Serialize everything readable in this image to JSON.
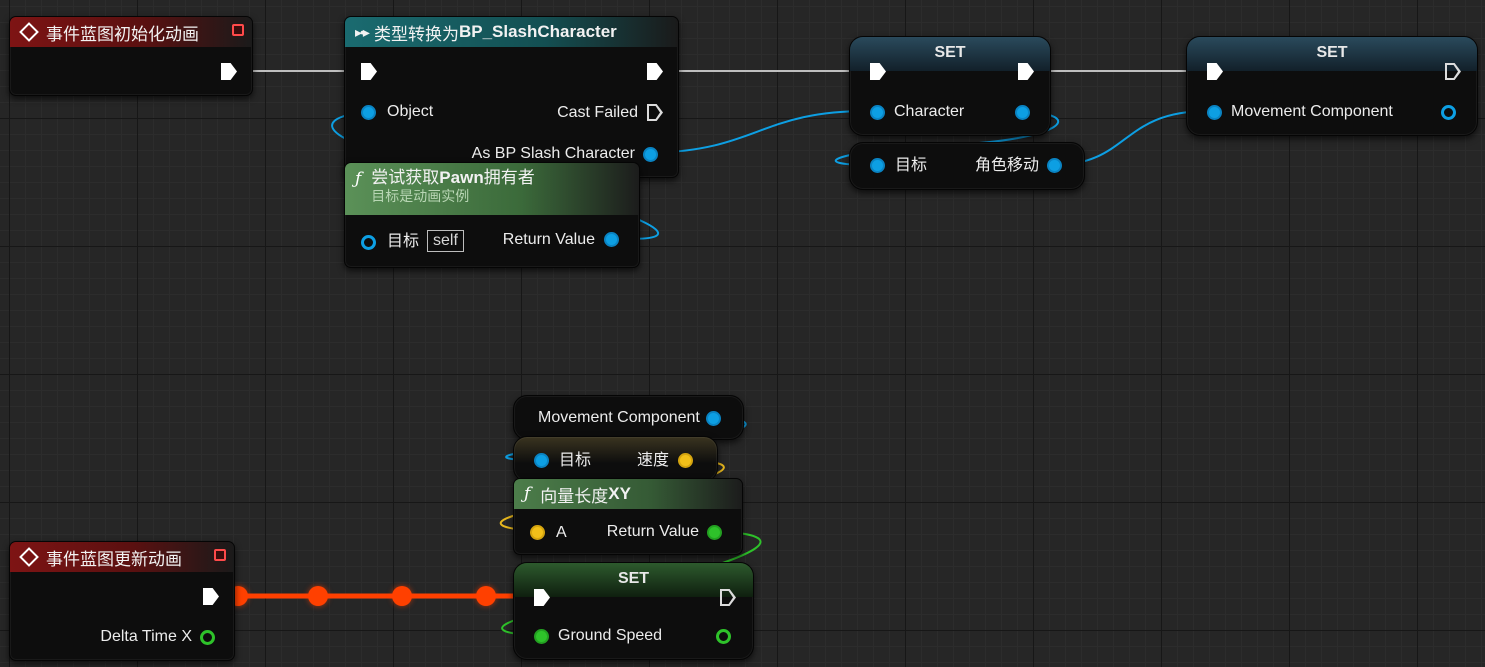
{
  "event_init": {
    "title": "事件蓝图初始化动画"
  },
  "cast": {
    "title_prefix": "类型转换为 ",
    "title_bold": "BP_SlashCharacter",
    "object_label": "Object",
    "cast_failed_label": "Cast Failed",
    "as_label": "As BP Slash Character"
  },
  "get_pawn": {
    "title_prefix": "尝试获取",
    "title_bold": "Pawn",
    "title_suffix": "拥有者",
    "subtitle": "目标是动画实例",
    "target_label": "目标",
    "self_label": "self",
    "return_label": "Return Value"
  },
  "set_character": {
    "title": "SET",
    "pin_label": "Character"
  },
  "get_movement": {
    "target_label": "目标",
    "output_label": "角色移动"
  },
  "set_movement": {
    "title": "SET",
    "pin_label": "Movement Component"
  },
  "movement_var": {
    "label": "Movement Component"
  },
  "velocity": {
    "target_label": "目标",
    "output_label": "速度"
  },
  "vector_length": {
    "title_prefix": "向量长度",
    "title_bold": "XY",
    "input_label": "A",
    "return_label": "Return Value"
  },
  "event_update": {
    "title": "事件蓝图更新动画",
    "delta_label": "Delta Time X"
  },
  "set_ground": {
    "title": "SET",
    "pin_label": "Ground Speed"
  },
  "colors": {
    "object_pin": "#0d9fe3",
    "float_pin": "#2ec22a",
    "vector_pin": "#f2c019",
    "exec_wire": "#ff4000",
    "event_header": "#7e1414",
    "function_header": "#5b9158",
    "cast_header": "#1a6b70"
  }
}
